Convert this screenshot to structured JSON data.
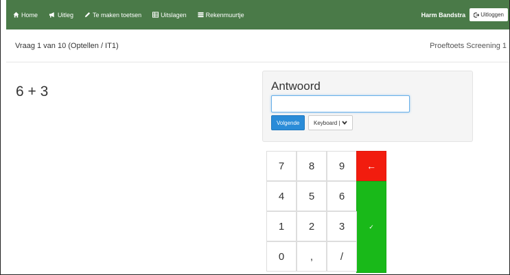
{
  "navbar": {
    "items": [
      {
        "label": "Home",
        "icon": "home-icon"
      },
      {
        "label": "Uitleg",
        "icon": "bullhorn-icon"
      },
      {
        "label": "Te maken toetsen",
        "icon": "pencil-icon"
      },
      {
        "label": "Uitslagen",
        "icon": "table-icon"
      },
      {
        "label": "Rekenmuurtje",
        "icon": "list-icon"
      }
    ],
    "user_name": "Harm Bandstra",
    "logout_label": "Uitloggen",
    "color": "#4a7a48"
  },
  "header": {
    "question_info": "Vraag 1 van 10 (Optellen / IT1)",
    "test_name": "Proeftoets Screening 1"
  },
  "question": {
    "text": "6 + 3"
  },
  "answer": {
    "label": "Antwoord",
    "value": "",
    "next_label": "Volgende",
    "keyboard_label": "Keyboard |"
  },
  "keypad": {
    "keys": [
      "7",
      "8",
      "9",
      "4",
      "5",
      "6",
      "1",
      "2",
      "3",
      "0",
      ",",
      "/"
    ],
    "backspace": "←",
    "confirm": "✓",
    "backspace_color": "#f21c0e",
    "confirm_color": "#19b919"
  }
}
